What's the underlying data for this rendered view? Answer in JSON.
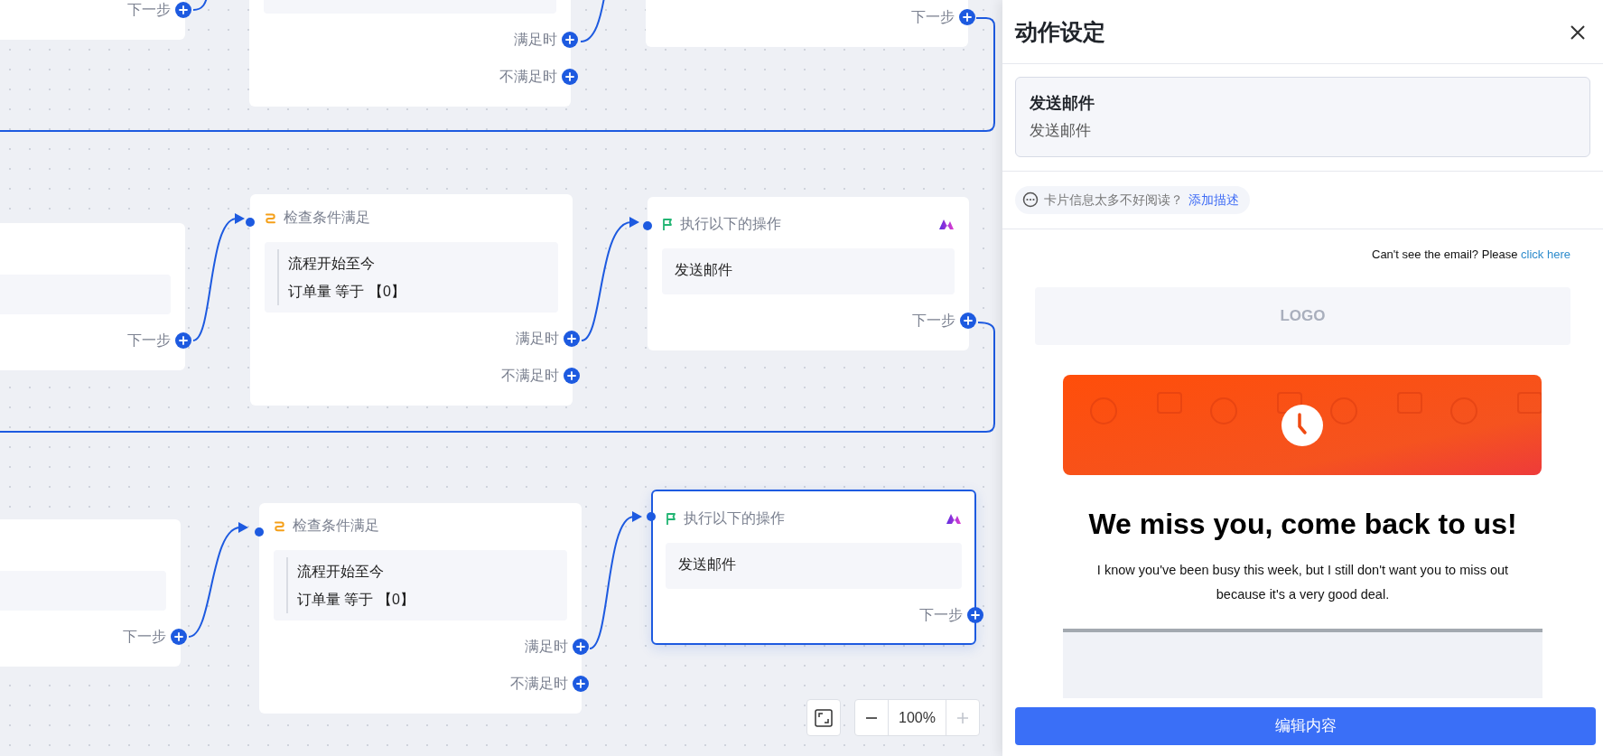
{
  "canvas": {
    "nodes": [
      {
        "kind": "start",
        "next_label": "下一步"
      },
      {
        "kind": "condition",
        "outputs": [
          "满足时",
          "不满足时"
        ]
      },
      {
        "kind": "action",
        "next_label": "下一步",
        "selected": false
      },
      {
        "kind": "start",
        "next_label": "下一步"
      },
      {
        "kind": "condition",
        "title": "检查条件满足",
        "lines": [
          "流程开始至今",
          "订单量 等于 【0】"
        ],
        "outputs": [
          "满足时",
          "不满足时"
        ]
      },
      {
        "kind": "action",
        "title": "执行以下的操作",
        "body": "发送邮件",
        "next_label": "下一步",
        "selected": false
      },
      {
        "kind": "start",
        "next_label": "下一步"
      },
      {
        "kind": "condition",
        "title": "检查条件满足",
        "lines": [
          "流程开始至今",
          "订单量 等于 【0】"
        ],
        "outputs": [
          "满足时",
          "不满足时"
        ]
      },
      {
        "kind": "action",
        "title": "执行以下的操作",
        "body": "发送邮件",
        "next_label": "下一步",
        "selected": true
      }
    ]
  },
  "zoom": {
    "level": "100%",
    "zoom_out_disabled": false,
    "zoom_in_disabled": true
  },
  "panel": {
    "title": "动作设定",
    "summary": {
      "title": "发送邮件",
      "subtitle": "发送邮件"
    },
    "hint": {
      "text": "卡片信息太多不好阅读？",
      "link": "添加描述"
    },
    "email": {
      "notice": "Can't see the email? Please",
      "notice_link": "click here",
      "logo": "LOGO",
      "heading": "We miss you, come back to us!",
      "body": "I know you've been busy this week, but I still don't want you to miss out because it's a very good deal."
    },
    "primary_button": "编辑内容"
  }
}
